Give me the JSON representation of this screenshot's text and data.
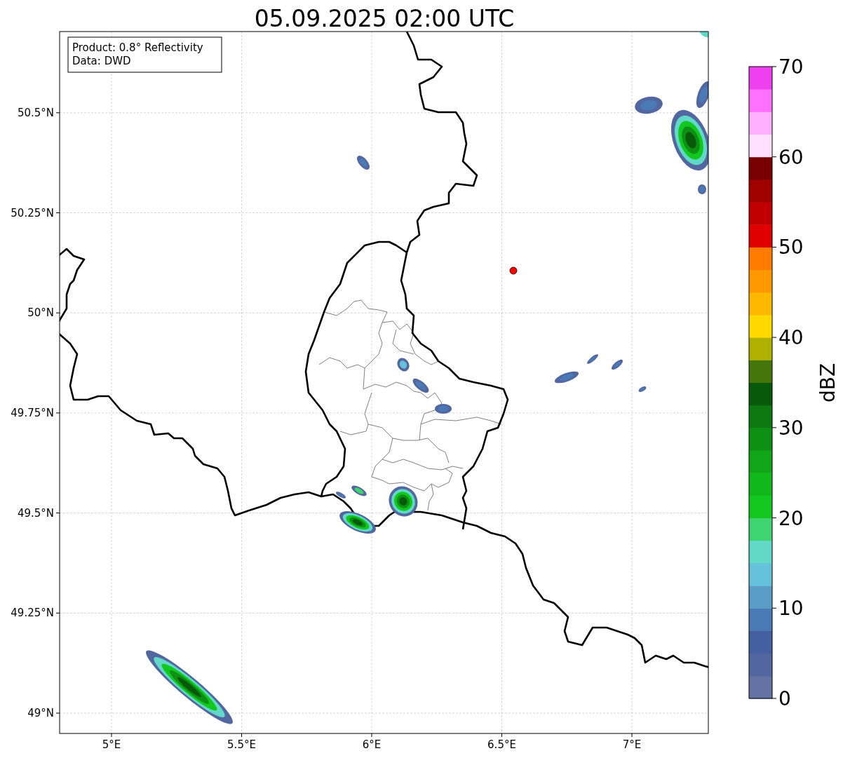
{
  "title": "05.09.2025 02:00 UTC",
  "info_box": {
    "lines": [
      "Product: 0.8° Reflectivity",
      "Data: DWD"
    ]
  },
  "map": {
    "x_ticks": [
      "5°E",
      "5.5°E",
      "6°E",
      "6.5°E",
      "7°E"
    ],
    "y_ticks": [
      "50.5°N",
      "50.25°N",
      "50°N",
      "49.75°N",
      "49.5°N",
      "49.25°N",
      "49°N"
    ]
  },
  "colorbar": {
    "label": "dBZ",
    "ticks": [
      "70",
      "60",
      "50",
      "40",
      "30",
      "20",
      "10",
      "0"
    ],
    "segments": [
      {
        "color": "#6472a4"
      },
      {
        "color": "#5266a0"
      },
      {
        "color": "#4460a0"
      },
      {
        "color": "#4a7ab6"
      },
      {
        "color": "#5a9ec8"
      },
      {
        "color": "#66c2dc"
      },
      {
        "color": "#62d8c8"
      },
      {
        "color": "#3ed470"
      },
      {
        "color": "#12c81e"
      },
      {
        "color": "#10b81a"
      },
      {
        "color": "#10a618"
      },
      {
        "color": "#0e9014"
      },
      {
        "color": "#0c7a10"
      },
      {
        "color": "#085a0a"
      },
      {
        "color": "#44760c"
      },
      {
        "color": "#b0b000"
      },
      {
        "color": "#ffd800"
      },
      {
        "color": "#ffb800"
      },
      {
        "color": "#ff9800"
      },
      {
        "color": "#ff7c00"
      },
      {
        "color": "#e00000"
      },
      {
        "color": "#c00000"
      },
      {
        "color": "#a00000"
      },
      {
        "color": "#780000"
      },
      {
        "color": "#ffe0ff"
      },
      {
        "color": "#ffb0ff"
      },
      {
        "color": "#ff70ff"
      },
      {
        "color": "#ee40ee"
      }
    ]
  }
}
